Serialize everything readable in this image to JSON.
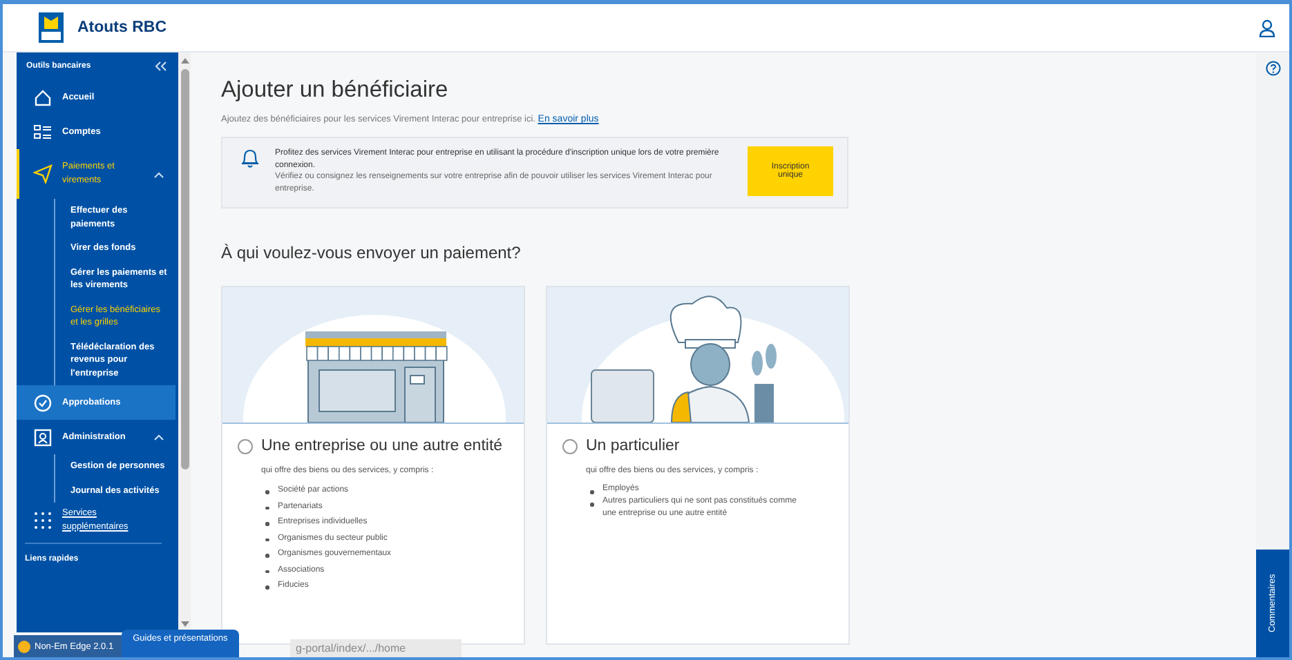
{
  "header": {
    "brand": "Atouts RBC"
  },
  "sidebar": {
    "section": "Outils bancaires",
    "quick_links": "Liens rapides",
    "items": [
      {
        "label": "Accueil",
        "kind": "home",
        "selected": false,
        "highlighted": false
      },
      {
        "label": "Comptes",
        "kind": "accounts",
        "selected": false,
        "highlighted": false
      },
      {
        "label": "Paiements et virements",
        "kind": "payments",
        "selected": true,
        "highlighted": false,
        "expanded": true,
        "children": [
          {
            "label": "Effectuer des paiements",
            "selected": false
          },
          {
            "label": "Virer des fonds",
            "selected": false
          },
          {
            "label": "Gérer les paiements et les virements",
            "selected": false
          },
          {
            "label": "Gérer les bénéficiaires et les grilles",
            "selected": true
          },
          {
            "label": "Télédéclaration des revenus pour l'entreprise",
            "selected": false
          }
        ]
      },
      {
        "label": "Approbations",
        "kind": "approvals",
        "selected": false,
        "highlighted": true
      },
      {
        "label": "Administration",
        "kind": "admin",
        "selected": false,
        "highlighted": false,
        "expanded": true,
        "children": [
          {
            "label": "Gestion de personnes",
            "selected": false
          },
          {
            "label": "Journal des activités",
            "selected": false
          }
        ]
      },
      {
        "label": "Services supplémentaires",
        "kind": "link",
        "selected": false,
        "highlighted": false
      }
    ]
  },
  "main": {
    "title": "Ajouter un bénéficiaire",
    "subtitle": "Ajoutez des bénéficiaires pour les services Virement Interac pour entreprise ici.",
    "learn_more": "En savoir plus",
    "notice": {
      "lines": [
        "Profitez des services Virement Interac pour entreprise en utilisant la procédure d'inscription unique lors de votre première connexion.",
        "Vérifiez ou consignez les renseignements sur votre entreprise afin de pouvoir utiliser les services Virement Interac pour entreprise."
      ],
      "button": "Inscription unique"
    },
    "question": "À qui voulez-vous envoyer un paiement?",
    "options": [
      {
        "kind": "store",
        "title": "Une entreprise ou une autre entité",
        "selected": false,
        "intro": "qui offre des biens ou des services, y compris :",
        "items": [
          "Société par actions",
          "Partenariats",
          "Entreprises individuelles",
          "Organismes du secteur public",
          "Organismes gouvernementaux",
          "Associations",
          "Fiducies"
        ]
      },
      {
        "kind": "person",
        "title": "Un particulier",
        "selected": false,
        "intro": "qui offre des biens ou des services, y compris :",
        "items": [
          "Employés",
          "Autres particuliers qui ne sont pas constitués comme une entreprise ou une autre entité"
        ]
      }
    ]
  },
  "feedback_tab": "Commentaires",
  "overlay": {
    "badge": "Non-Em Edge 2.0.1",
    "tab": "Guides et présentations",
    "url": "g-portal/index/.../home"
  }
}
